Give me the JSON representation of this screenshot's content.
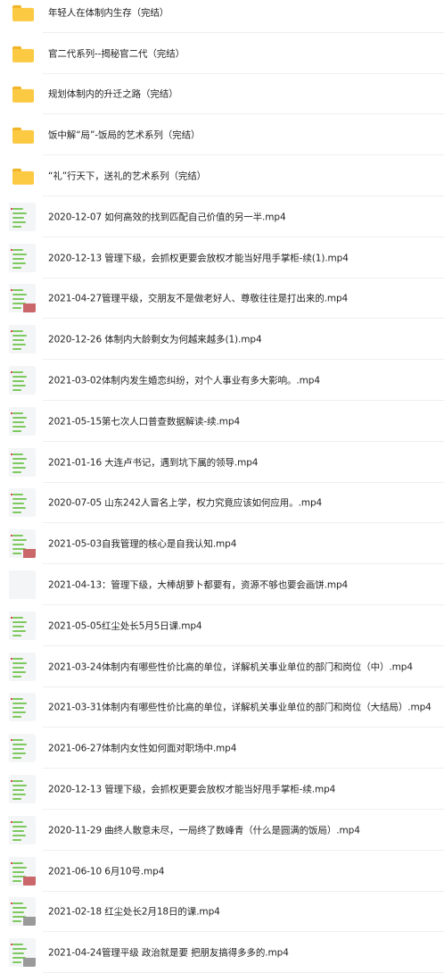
{
  "items": [
    {
      "type": "folder",
      "name": "年轻人在体制内生存（完结）"
    },
    {
      "type": "folder",
      "name": "官二代系列--揭秘官二代（完结）"
    },
    {
      "type": "folder",
      "name": "规划体制内的升迁之路（完结）"
    },
    {
      "type": "folder",
      "name": "饭中解“局”-饭局的艺术系列（完结）"
    },
    {
      "type": "folder",
      "name": "“礼”行天下，送礼的艺术系列（完结）"
    },
    {
      "type": "video",
      "name": "2020-12-07 如何高效的找到匹配自己价值的另一半.mp4"
    },
    {
      "type": "video",
      "name": "2020-12-13 管理下级，会抓权更要会放权才能当好甩手掌柜-续(1).mp4"
    },
    {
      "type": "video",
      "name": "2021-04-27管理平级，交朋友不是做老好人、尊敬往往是打出来的.mp4"
    },
    {
      "type": "video",
      "name": "2020-12-26 体制内大龄剩女为何越来越多(1).mp4"
    },
    {
      "type": "video",
      "name": "2021-03-02体制内发生婚恋纠纷，对个人事业有多大影响。.mp4"
    },
    {
      "type": "video",
      "name": "2021-05-15第七次人口普查数据解读-续.mp4"
    },
    {
      "type": "video",
      "name": "2021-01-16 大连卢书记，遇到坑下属的领导.mp4"
    },
    {
      "type": "video",
      "name": "2020-07-05 山东242人冒名上学，权力究竟应该如何应用。.mp4"
    },
    {
      "type": "video",
      "name": "2021-05-03自我管理的核心是自我认知.mp4"
    },
    {
      "type": "video",
      "name": "2021-04-13：管理下级，大棒胡萝卜都要有，资源不够也要会画饼.mp4"
    },
    {
      "type": "video",
      "name": "2021-05-05红尘处长5月5日课.mp4"
    },
    {
      "type": "video",
      "name": "2021-03-24体制内有哪些性价比高的单位，详解机关事业单位的部门和岗位（中）.mp4"
    },
    {
      "type": "video",
      "name": "2021-03-31体制内有哪些性价比高的单位，详解机关事业单位的部门和岗位（大结局）.mp4"
    },
    {
      "type": "video",
      "name": "2021-06-27体制内女性如何面对职场中.mp4"
    },
    {
      "type": "video",
      "name": "2020-12-13 管理下级，会抓权更要会放权才能当好甩手掌柜-续.mp4"
    },
    {
      "type": "video",
      "name": "2020-11-29 曲终人散意未尽，一局终了数峰青（什么是圆满的饭局）.mp4"
    },
    {
      "type": "video",
      "name": "2021-06-10 6月10号.mp4"
    },
    {
      "type": "video",
      "name": "2021-02-18 红尘处长2月18日的课.mp4"
    },
    {
      "type": "video",
      "name": "2021-04-24管理平级 政治就是要 把朋友搞得多多的.mp4"
    }
  ],
  "colors": {
    "folder": "#fcc943",
    "thumbnail_lines": "#7dc95e",
    "divider": "#efefef"
  }
}
